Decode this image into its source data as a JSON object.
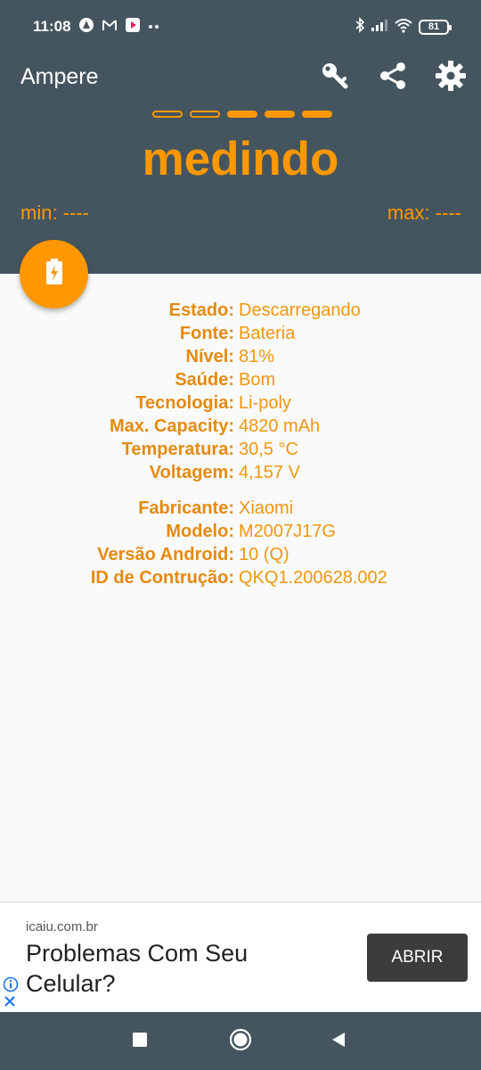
{
  "status_bar": {
    "time": "11:08",
    "battery_level": "81",
    "left_icons": [
      "assistant-icon",
      "gmail-icon",
      "youtube-music-icon",
      "more-dots-icon"
    ],
    "right_icons": [
      "bluetooth-icon",
      "signal-icon",
      "wifi-icon",
      "battery-icon"
    ]
  },
  "app_bar": {
    "title": "Ampere",
    "actions": [
      "key-icon",
      "share-icon",
      "gear-icon"
    ]
  },
  "measurement": {
    "status": "medindo",
    "min_label": "min: ----",
    "max_label": "max: ----",
    "indicator_dashes": [
      "hollow",
      "hollow",
      "filled",
      "filled",
      "filled"
    ]
  },
  "battery_info": [
    {
      "label": "Estado:",
      "value": "Descarregando"
    },
    {
      "label": "Fonte:",
      "value": "Bateria"
    },
    {
      "label": "Nível:",
      "value": "81%"
    },
    {
      "label": "Saúde:",
      "value": "Bom"
    },
    {
      "label": "Tecnologia:",
      "value": "Li-poly"
    },
    {
      "label": "Max. Capacity:",
      "value": "4820 mAh"
    },
    {
      "label": "Temperatura:",
      "value": "30,5 °C"
    },
    {
      "label": "Voltagem:",
      "value": "4,157 V"
    }
  ],
  "device_info": [
    {
      "label": "Fabricante:",
      "value": "Xiaomi"
    },
    {
      "label": "Modelo:",
      "value": "M2007J17G"
    },
    {
      "label": "Versão Android:",
      "value": "10 (Q)"
    },
    {
      "label": "ID de Contrução:",
      "value": "QKQ1.200628.002"
    }
  ],
  "ad": {
    "domain": "icaiu.com.br",
    "headline": "Problemas Com Seu Celular?",
    "button": "ABRIR"
  },
  "colors": {
    "toolbar": "#45555f",
    "accent": "#ff9800",
    "label": "#e48a10",
    "background": "#fafafa"
  }
}
